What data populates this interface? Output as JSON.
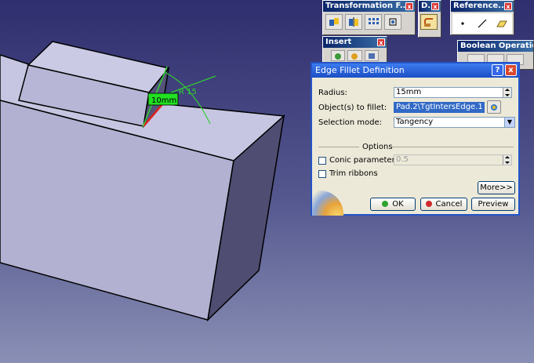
{
  "toolbars": {
    "transformation": {
      "title": "Transformation F..."
    },
    "dress_up": {
      "title": "D.."
    },
    "reference": {
      "title": "Reference..."
    },
    "insert": {
      "title": "Insert"
    },
    "boolean": {
      "title": "Boolean Operations"
    },
    "close_glyph": "x"
  },
  "viewport": {
    "dimension_label": "10mm",
    "radius_annotation": "R 15"
  },
  "dialog": {
    "title": "Edge Fillet Definition",
    "help_glyph": "?",
    "close_glyph": "x",
    "radius_label": "Radius:",
    "radius_value": "15mm",
    "objects_label": "Object(s) to fillet:",
    "objects_value": "Pad.2\\TgtIntersEdge.1",
    "selection_mode_label": "Selection mode:",
    "selection_mode_value": "Tangency",
    "options_heading": "Options",
    "conic_label": "Conic parameter:",
    "conic_value": "0.5",
    "trim_label": "Trim ribbons",
    "more_label": "More>>",
    "ok_label": "OK",
    "cancel_label": "Cancel",
    "preview_label": "Preview"
  }
}
